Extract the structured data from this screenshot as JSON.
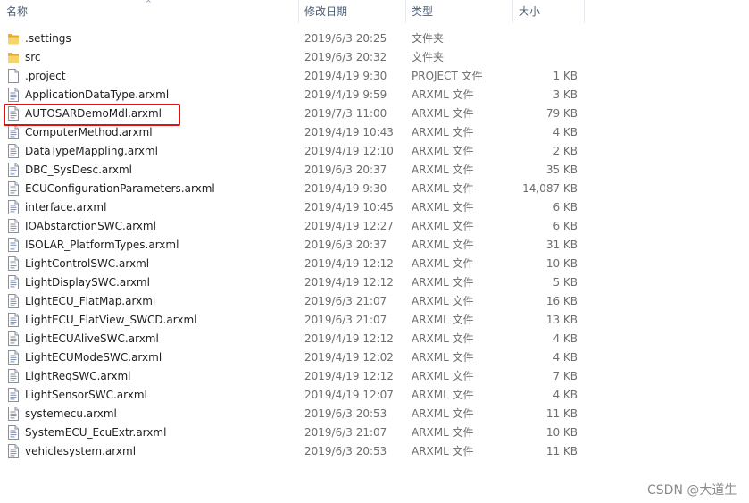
{
  "header": {
    "name": "名称",
    "date": "修改日期",
    "type": "类型",
    "size": "大小"
  },
  "files": [
    {
      "name": ".settings",
      "date": "2019/6/3 20:25",
      "type": "文件夹",
      "size": "",
      "icon": "folder-icon"
    },
    {
      "name": "src",
      "date": "2019/6/3 20:32",
      "type": "文件夹",
      "size": "",
      "icon": "folder-icon"
    },
    {
      "name": ".project",
      "date": "2019/4/19 9:30",
      "type": "PROJECT 文件",
      "size": "1 KB",
      "icon": "blank-file-icon"
    },
    {
      "name": "ApplicationDataType.arxml",
      "date": "2019/4/19 9:59",
      "type": "ARXML 文件",
      "size": "3 KB",
      "icon": "document-file-icon"
    },
    {
      "name": "AUTOSARDemoMdl.arxml",
      "date": "2019/7/3 11:00",
      "type": "ARXML 文件",
      "size": "79 KB",
      "icon": "document-file-icon"
    },
    {
      "name": "ComputerMethod.arxml",
      "date": "2019/4/19 10:43",
      "type": "ARXML 文件",
      "size": "4 KB",
      "icon": "document-file-icon"
    },
    {
      "name": "DataTypeMappling.arxml",
      "date": "2019/4/19 12:10",
      "type": "ARXML 文件",
      "size": "2 KB",
      "icon": "document-file-icon"
    },
    {
      "name": "DBC_SysDesc.arxml",
      "date": "2019/6/3 20:37",
      "type": "ARXML 文件",
      "size": "35 KB",
      "icon": "document-file-icon"
    },
    {
      "name": "ECUConfigurationParameters.arxml",
      "date": "2019/4/19 9:30",
      "type": "ARXML 文件",
      "size": "14,087 KB",
      "icon": "document-file-icon"
    },
    {
      "name": "interface.arxml",
      "date": "2019/4/19 10:45",
      "type": "ARXML 文件",
      "size": "6 KB",
      "icon": "document-file-icon"
    },
    {
      "name": "IOAbstarctionSWC.arxml",
      "date": "2019/4/19 12:27",
      "type": "ARXML 文件",
      "size": "6 KB",
      "icon": "document-file-icon"
    },
    {
      "name": "ISOLAR_PlatformTypes.arxml",
      "date": "2019/6/3 20:37",
      "type": "ARXML 文件",
      "size": "31 KB",
      "icon": "document-file-icon"
    },
    {
      "name": "LightControlSWC.arxml",
      "date": "2019/4/19 12:12",
      "type": "ARXML 文件",
      "size": "10 KB",
      "icon": "document-file-icon"
    },
    {
      "name": "LightDisplaySWC.arxml",
      "date": "2019/4/19 12:12",
      "type": "ARXML 文件",
      "size": "5 KB",
      "icon": "document-file-icon"
    },
    {
      "name": "LightECU_FlatMap.arxml",
      "date": "2019/6/3 21:07",
      "type": "ARXML 文件",
      "size": "16 KB",
      "icon": "document-file-icon"
    },
    {
      "name": "LightECU_FlatView_SWCD.arxml",
      "date": "2019/6/3 21:07",
      "type": "ARXML 文件",
      "size": "13 KB",
      "icon": "document-file-icon"
    },
    {
      "name": "LightECUAliveSWC.arxml",
      "date": "2019/4/19 12:12",
      "type": "ARXML 文件",
      "size": "4 KB",
      "icon": "document-file-icon"
    },
    {
      "name": "LightECUModeSWC.arxml",
      "date": "2019/4/19 12:02",
      "type": "ARXML 文件",
      "size": "4 KB",
      "icon": "document-file-icon"
    },
    {
      "name": "LightReqSWC.arxml",
      "date": "2019/4/19 12:12",
      "type": "ARXML 文件",
      "size": "7 KB",
      "icon": "document-file-icon"
    },
    {
      "name": "LightSensorSWC.arxml",
      "date": "2019/4/19 12:07",
      "type": "ARXML 文件",
      "size": "4 KB",
      "icon": "document-file-icon"
    },
    {
      "name": "systemecu.arxml",
      "date": "2019/6/3 20:53",
      "type": "ARXML 文件",
      "size": "11 KB",
      "icon": "document-file-icon"
    },
    {
      "name": "SystemECU_EcuExtr.arxml",
      "date": "2019/6/3 21:07",
      "type": "ARXML 文件",
      "size": "10 KB",
      "icon": "document-file-icon"
    },
    {
      "name": "vehiclesystem.arxml",
      "date": "2019/6/3 20:53",
      "type": "ARXML 文件",
      "size": "11 KB",
      "icon": "document-file-icon"
    }
  ],
  "watermark": "CSDN @大道生"
}
